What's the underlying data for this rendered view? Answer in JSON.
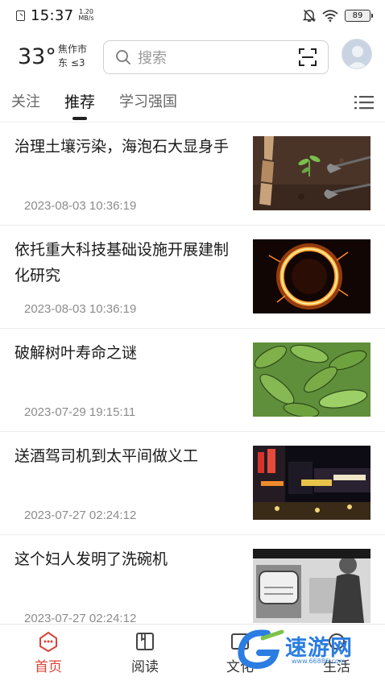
{
  "status_bar": {
    "time": "15:37",
    "net_speed_value": "1.20",
    "net_speed_unit": "MB/s",
    "battery": "89"
  },
  "header": {
    "temperature": "33°",
    "city": "焦作市",
    "wind": "东  ≤3",
    "search_placeholder": "搜索"
  },
  "tabs": [
    {
      "label": "关注"
    },
    {
      "label": "推荐"
    },
    {
      "label": "学习强国"
    }
  ],
  "news": [
    {
      "title": "治理土壤污染，海泡石大显身手",
      "date": "2023-08-03 10:36:19"
    },
    {
      "title": "依托重大科技基础设施开展建制化研究",
      "date": "2023-08-03 10:36:19"
    },
    {
      "title": "破解树叶寿命之谜",
      "date": "2023-07-29 19:15:11"
    },
    {
      "title": "送酒驾司机到太平间做义工",
      "date": "2023-07-27 02:24:12"
    },
    {
      "title": "这个妇人发明了洗碗机",
      "date": "2023-07-27 02:24:12"
    }
  ],
  "bottom_nav": [
    {
      "label": "首页",
      "icon": "home-icon"
    },
    {
      "label": "阅读",
      "icon": "book-icon"
    },
    {
      "label": "文化",
      "icon": "culture-icon"
    },
    {
      "label": "生活",
      "icon": "life-icon"
    }
  ],
  "watermark": {
    "text": "速游网",
    "url": "www.66886.com"
  },
  "colors": {
    "accent": "#d94437",
    "watermark": "#2b7de1"
  }
}
